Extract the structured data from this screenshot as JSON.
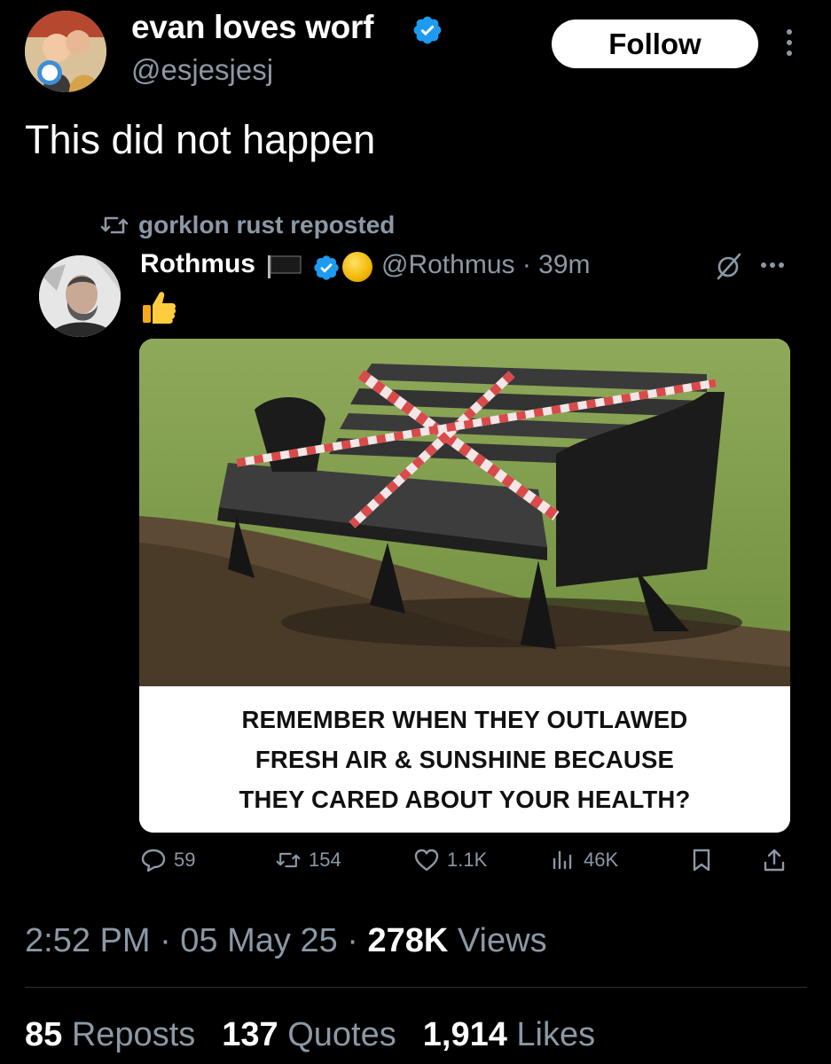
{
  "header": {
    "display_name": "evan loves worf",
    "handle": "@esjesjesj",
    "follow_label": "Follow"
  },
  "tweet": {
    "text": "This did not happen"
  },
  "quoted": {
    "reposted_by": "gorklon rust reposted",
    "name": "Rothmus",
    "meta": "@Rothmus · 39m",
    "emoji": "👍",
    "caption_lines": [
      "REMEMBER WHEN THEY OUTLAWED",
      "FRESH AIR & SUNSHINE BECAUSE",
      "THEY CARED ABOUT YOUR HEALTH?"
    ],
    "actions": {
      "replies": "59",
      "reposts": "154",
      "likes": "1.1K",
      "views": "46K"
    }
  },
  "footer": {
    "time": "2:52 PM · 05 May 25 · ",
    "views_count": "278K",
    "views_label": " Views",
    "reposts_count": "85",
    "reposts_label": "Reposts",
    "quotes_count": "137",
    "quotes_label": "Quotes",
    "likes_count": "1,914",
    "likes_label": "Likes"
  },
  "colors": {
    "background": "#000000",
    "verified": "#1d9bf0",
    "muted": "#8b98a5"
  }
}
